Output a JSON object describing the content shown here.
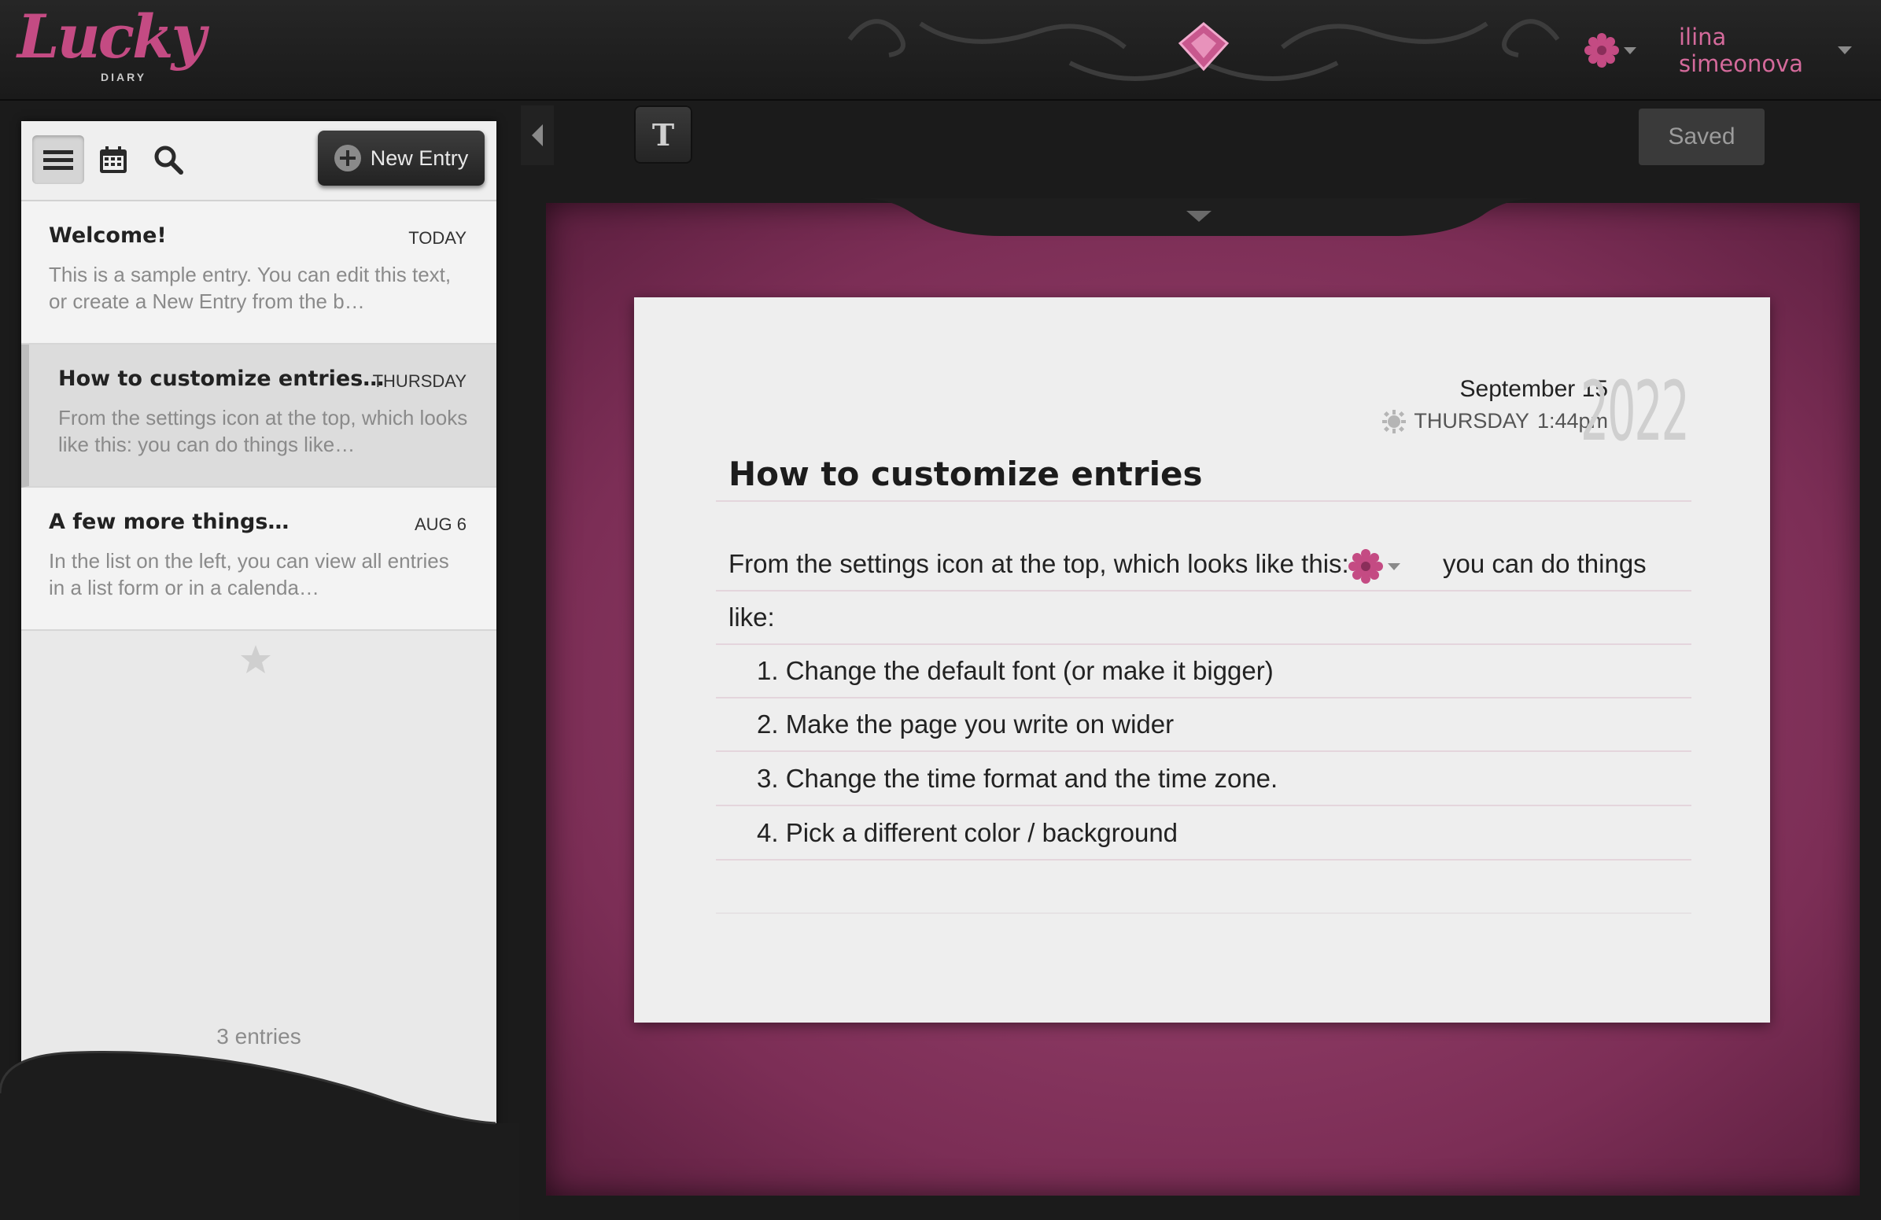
{
  "app": {
    "logo_text": "Lucky",
    "logo_sub": "DIARY",
    "user_name": "ilina simeonova",
    "accent_color": "#c44b83"
  },
  "sidebar": {
    "tools": [
      {
        "name": "list-view",
        "icon": "list-icon",
        "active": true
      },
      {
        "name": "calendar-view",
        "icon": "calendar-icon",
        "active": false
      },
      {
        "name": "search",
        "icon": "search-icon",
        "active": false
      }
    ],
    "new_entry_label": "New Entry",
    "entries": [
      {
        "title": "Welcome!",
        "date": "TODAY",
        "snippet": "This is a sample entry. You can edit this text, or create a New Entry from the b…"
      },
      {
        "title": "How to customize entries…",
        "date": "THURSDAY",
        "snippet": "From the settings icon at the top, which looks like this: you can do things like…"
      },
      {
        "title": "A few more things…",
        "date": "AUG 6",
        "snippet": "In the list on the left, you can view all entries in a list form or in a calenda…"
      }
    ],
    "entries_count": "3 entries"
  },
  "toolbar": {
    "text_tool_label": "T",
    "saved_label": "Saved"
  },
  "editor": {
    "date": "September 15",
    "weekday": "THURSDAY",
    "time": "1:44pm",
    "year": "2022",
    "title": "How to customize entries",
    "paragraph_start": "From the settings icon at the top, which looks like this:",
    "paragraph_end": "you can do things",
    "paragraph_cont": "like:",
    "list": [
      "1. Change the default font (or make it bigger)",
      "2. Make the page you write on wider",
      "3. Change the time format and the time zone.",
      "4. Pick a different color / background"
    ]
  }
}
